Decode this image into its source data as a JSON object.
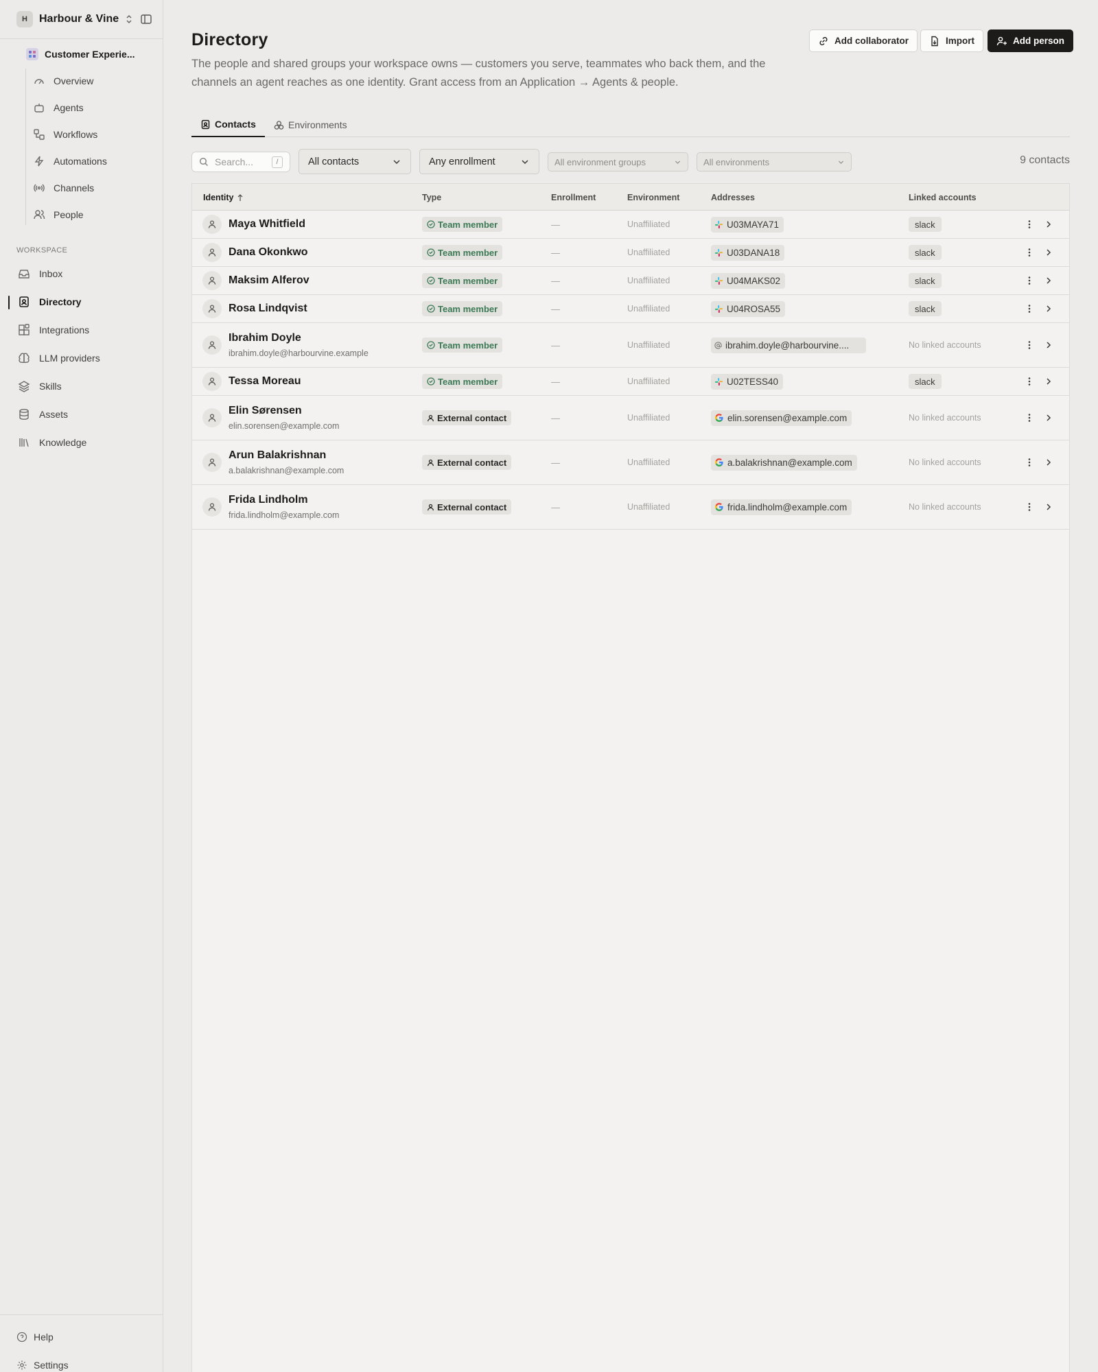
{
  "workspace": {
    "initial": "H",
    "name": "Harbour & Vine"
  },
  "project": {
    "name": "Customer Experie..."
  },
  "project_nav": [
    {
      "label": "Overview",
      "icon": "gauge-icon"
    },
    {
      "label": "Agents",
      "icon": "bot-icon"
    },
    {
      "label": "Workflows",
      "icon": "workflow-icon"
    },
    {
      "label": "Automations",
      "icon": "lightning-icon"
    },
    {
      "label": "Channels",
      "icon": "broadcast-icon"
    },
    {
      "label": "People",
      "icon": "people-icon"
    }
  ],
  "workspace_section_label": "WORKSPACE",
  "workspace_nav": [
    {
      "label": "Inbox",
      "icon": "inbox-icon"
    },
    {
      "label": "Directory",
      "icon": "contact-book-icon",
      "active": true
    },
    {
      "label": "Integrations",
      "icon": "integrations-icon"
    },
    {
      "label": "LLM providers",
      "icon": "brain-icon"
    },
    {
      "label": "Skills",
      "icon": "layers-icon"
    },
    {
      "label": "Assets",
      "icon": "database-icon"
    },
    {
      "label": "Knowledge",
      "icon": "library-icon"
    }
  ],
  "footer": {
    "help": "Help",
    "settings": "Settings"
  },
  "page": {
    "title": "Directory",
    "description": "The people and shared groups your workspace owns — customers you serve, teammates who back them, and the channels an agent reaches as one identity. Grant access from an Application → Agents & people."
  },
  "actions": {
    "add_collaborator": "Add collaborator",
    "import": "Import",
    "add_person": "Add person"
  },
  "tabs": [
    {
      "label": "Contacts",
      "active": true
    },
    {
      "label": "Environments",
      "active": false
    }
  ],
  "filters": {
    "search_placeholder": "Search...",
    "search_shortcut": "/",
    "contacts": "All contacts",
    "enrollment": "Any enrollment",
    "env_groups": "All environment groups",
    "environments": "All environments",
    "count": "9 contacts"
  },
  "table": {
    "columns": {
      "identity": "Identity",
      "type": "Type",
      "enrollment": "Enrollment",
      "environment": "Environment",
      "addresses": "Addresses",
      "linked": "Linked accounts"
    },
    "rows": [
      {
        "name": "Maya Whitfield",
        "email": "",
        "type": "Team member",
        "enrollment": "—",
        "environment": "Unaffiliated",
        "address": "U03MAYA71",
        "address_kind": "slack",
        "linked": "slack"
      },
      {
        "name": "Dana Okonkwo",
        "email": "",
        "type": "Team member",
        "enrollment": "—",
        "environment": "Unaffiliated",
        "address": "U03DANA18",
        "address_kind": "slack",
        "linked": "slack"
      },
      {
        "name": "Maksim Alferov",
        "email": "",
        "type": "Team member",
        "enrollment": "—",
        "environment": "Unaffiliated",
        "address": "U04MAKS02",
        "address_kind": "slack",
        "linked": "slack"
      },
      {
        "name": "Rosa Lindqvist",
        "email": "",
        "type": "Team member",
        "enrollment": "—",
        "environment": "Unaffiliated",
        "address": "U04ROSA55",
        "address_kind": "slack",
        "linked": "slack"
      },
      {
        "name": "Ibrahim Doyle",
        "email": "ibrahim.doyle@harbourvine.example",
        "type": "Team member",
        "enrollment": "—",
        "environment": "Unaffiliated",
        "address": "ibrahim.doyle@harbourvine....",
        "address_kind": "email",
        "linked": "No linked accounts"
      },
      {
        "name": "Tessa Moreau",
        "email": "",
        "type": "Team member",
        "enrollment": "—",
        "environment": "Unaffiliated",
        "address": "U02TESS40",
        "address_kind": "slack",
        "linked": "slack"
      },
      {
        "name": "Elin Sørensen",
        "email": "elin.sorensen@example.com",
        "type": "External contact",
        "enrollment": "—",
        "environment": "Unaffiliated",
        "address": "elin.sorensen@example.com",
        "address_kind": "google",
        "linked": "No linked accounts"
      },
      {
        "name": "Arun Balakrishnan",
        "email": "a.balakrishnan@example.com",
        "type": "External contact",
        "enrollment": "—",
        "environment": "Unaffiliated",
        "address": "a.balakrishnan@example.com",
        "address_kind": "google",
        "linked": "No linked accounts"
      },
      {
        "name": "Frida Lindholm",
        "email": "frida.lindholm@example.com",
        "type": "External contact",
        "enrollment": "—",
        "environment": "Unaffiliated",
        "address": "frida.lindholm@example.com",
        "address_kind": "google",
        "linked": "No linked accounts"
      }
    ]
  },
  "colors": {
    "accent": "#1c1b1a",
    "team_member": "#3c7a55",
    "background": "#ecebe9"
  }
}
